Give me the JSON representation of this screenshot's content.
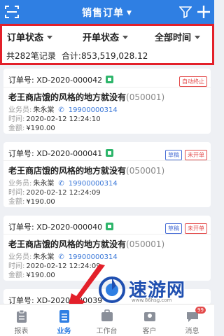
{
  "header": {
    "title": "销售订单"
  },
  "filters": {
    "items": [
      "订单状态",
      "开单状态",
      "全部时间"
    ],
    "summary_count": "共282笔记录",
    "summary_total": "合计:853,519,028.12"
  },
  "orders": [
    {
      "order_no": "订单号: XD-2020-000042",
      "tags": [
        "自动终止"
      ],
      "shop": "老王商店饿的风格的地方就没有",
      "shop_code": "(050001)",
      "salesman_label": "业务员:",
      "salesman": "朱永棠",
      "phone": "19900000314",
      "time_label": "时间:",
      "time": "2020-02-12 12:24:10",
      "amount_label": "金额:",
      "amount": "¥190.00"
    },
    {
      "order_no": "订单号: XD-2020-000041",
      "tags": [
        "草稿",
        "未开单"
      ],
      "shop": "老王商店饿的风格的地方就没有",
      "shop_code": "(050001)",
      "salesman_label": "业务员:",
      "salesman": "朱永棠",
      "phone": "19900000314",
      "time_label": "时间:",
      "time": "2020-02-12 12:24:09",
      "amount_label": "金额:",
      "amount": "¥190.00"
    },
    {
      "order_no": "订单号: XD-2020-000040",
      "tags": [
        "草稿",
        "未开单"
      ],
      "shop": "老王商店饿的风格的地方就没有",
      "shop_code": "(050001)",
      "salesman_label": "业务员:",
      "salesman": "朱永棠",
      "phone": "19900000314",
      "time_label": "时间:",
      "time": "2020-02-12 12:24:09",
      "amount_label": "金额:",
      "amount": "¥190.00"
    },
    {
      "order_no": "订单号: XD-2020-000039"
    }
  ],
  "tabbar": {
    "items": [
      "报表",
      "业务",
      "工作台",
      "客户",
      "消息"
    ],
    "active": "业务",
    "message_badge": "99"
  },
  "watermark": {
    "text": "速游网",
    "url": "www.86hsg.com"
  },
  "colors": {
    "primary": "#2f7fe3",
    "highlight_border": "#e3202a",
    "tag_red": "#e34a4a",
    "tag_blue": "#4a6fd6",
    "status_green": "#2db56a"
  }
}
